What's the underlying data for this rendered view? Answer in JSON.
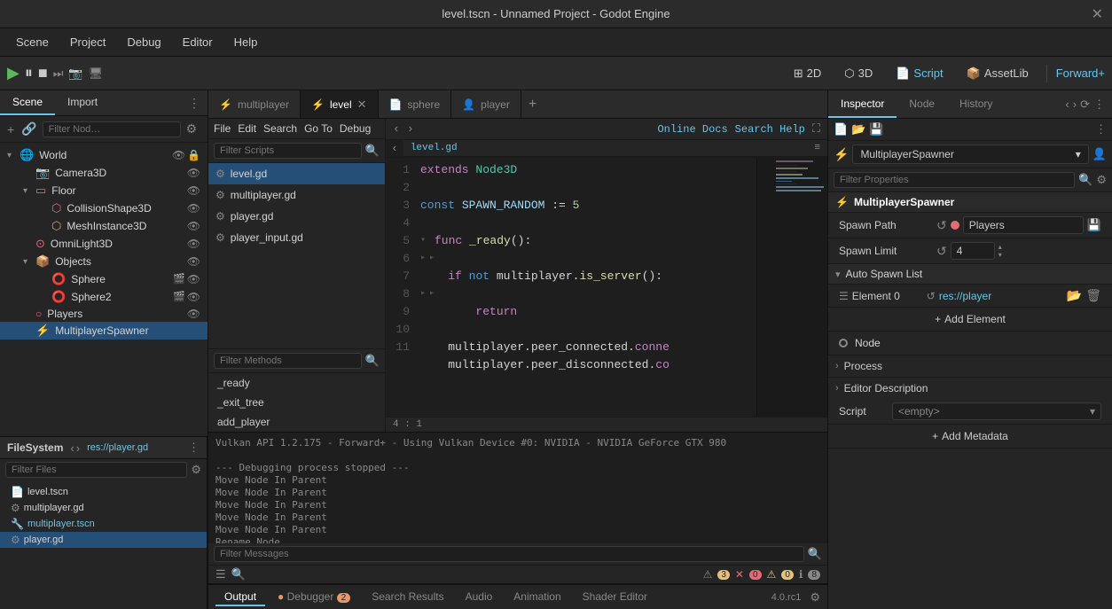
{
  "titleBar": {
    "title": "level.tscn - Unnamed Project - Godot Engine",
    "closeIcon": "✕"
  },
  "menuBar": {
    "items": [
      "Scene",
      "Project",
      "Debug",
      "Editor",
      "Help"
    ]
  },
  "toolbar": {
    "buttons": [
      {
        "label": "2D",
        "icon": "⊞",
        "active": false
      },
      {
        "label": "3D",
        "icon": "⬡",
        "active": false
      },
      {
        "label": "Script",
        "icon": "📄",
        "active": true
      },
      {
        "label": "AssetLib",
        "icon": "📦",
        "active": false
      }
    ],
    "playBtn": "▶",
    "pauseBtn": "⏸",
    "stopBtn": "■",
    "forwardPlus": "Forward+"
  },
  "scene": {
    "tabs": [
      "Scene",
      "Import"
    ],
    "activeTab": "Scene",
    "filterPlaceholder": "Filter Nod…",
    "tree": [
      {
        "label": "World",
        "icon": "🌐",
        "color": "node-blue",
        "depth": 0,
        "expanded": true,
        "hasEye": true
      },
      {
        "label": "Camera3D",
        "icon": "📷",
        "color": "node-red",
        "depth": 1,
        "hasEye": true
      },
      {
        "label": "Floor",
        "icon": "▭",
        "color": "node-red",
        "depth": 1,
        "expanded": true,
        "hasEye": true
      },
      {
        "label": "CollisionShape3D",
        "icon": "⬡",
        "color": "node-red",
        "depth": 2,
        "hasEye": true
      },
      {
        "label": "MeshInstance3D",
        "icon": "⬡",
        "color": "node-orange",
        "depth": 2,
        "hasEye": true
      },
      {
        "label": "OmniLight3D",
        "icon": "⊙",
        "color": "node-red",
        "depth": 1,
        "hasEye": true
      },
      {
        "label": "Objects",
        "icon": "📦",
        "color": "node-red",
        "depth": 1,
        "expanded": true,
        "hasEye": true
      },
      {
        "label": "Sphere",
        "icon": "⭕",
        "color": "node-orange",
        "depth": 2,
        "hasEye": true
      },
      {
        "label": "Sphere2",
        "icon": "⭕",
        "color": "node-orange",
        "depth": 2,
        "hasEye": true
      },
      {
        "label": "Players",
        "icon": "○",
        "color": "node-red",
        "depth": 1,
        "hasEye": true
      },
      {
        "label": "MultiplayerSpawner",
        "icon": "⚡",
        "color": "node-blue",
        "depth": 1,
        "selected": true,
        "hasEye": false
      }
    ]
  },
  "filesystem": {
    "title": "FileSystem",
    "path": "res://player.gd",
    "filterPlaceholder": "Filter Files",
    "items": [
      {
        "label": "level.tscn",
        "icon": "📄",
        "color": "orange"
      },
      {
        "label": "multiplayer.gd",
        "icon": "⚙",
        "color": "normal"
      },
      {
        "label": "multiplayer.tscn",
        "icon": "🔧",
        "color": "blue",
        "selected": false
      },
      {
        "label": "player.gd",
        "icon": "⚙",
        "color": "normal",
        "selected": true
      }
    ]
  },
  "editorTabs": [
    {
      "label": "multiplayer",
      "icon": "⚡",
      "closeable": false
    },
    {
      "label": "level",
      "icon": "⚡",
      "closeable": true,
      "active": true
    },
    {
      "label": "sphere",
      "icon": "📄",
      "closeable": false
    },
    {
      "label": "player",
      "icon": "👤",
      "closeable": false
    }
  ],
  "codeEditor": {
    "toolbar": {
      "file": "File",
      "edit": "Edit",
      "search": "Search",
      "goTo": "Go To",
      "debug": "Debug",
      "onlineHelp": "Online Docs",
      "searchHelp": "Search Help"
    },
    "scripts": [
      {
        "label": "level.gd",
        "active": true
      },
      {
        "label": "multiplayer.gd"
      },
      {
        "label": "player.gd"
      },
      {
        "label": "player_input.gd"
      }
    ],
    "breadcrumb": "level.gd",
    "methods": [
      "_ready",
      "_exit_tree",
      "add_player"
    ],
    "lines": [
      {
        "num": 1,
        "code": "extends Node3D"
      },
      {
        "num": 2,
        "code": ""
      },
      {
        "num": 3,
        "code": "const SPAWN_RANDOM := 5"
      },
      {
        "num": 4,
        "code": ""
      },
      {
        "num": 5,
        "code": "func _ready():"
      },
      {
        "num": 6,
        "code": "    if not multiplayer.is_server():"
      },
      {
        "num": 7,
        "code": "        return"
      },
      {
        "num": 8,
        "code": ""
      },
      {
        "num": 9,
        "code": "    multiplayer.peer_connected.conne"
      },
      {
        "num": 10,
        "code": "    multiplayer.peer_disconnected.co"
      },
      {
        "num": 11,
        "code": ""
      }
    ],
    "cursorPos": "4 : 1"
  },
  "console": {
    "output": [
      "Vulkan API 1.2.175 - Forward+ - Using Vulkan Device #0: NVIDIA - NVIDIA GeForce GTX 980",
      "",
      "--- Debugging process stopped ---",
      "Move Node In Parent",
      "Move Node In Parent",
      "Move Node In Parent",
      "Move Node In Parent",
      "Move Node In Parent",
      "Rename Node"
    ],
    "filterPlaceholder": "Filter Messages",
    "tabs": [
      "Output",
      "Debugger (2)",
      "Search Results",
      "Audio",
      "Animation",
      "Shader Editor"
    ],
    "activeTab": "Output",
    "debuggerCount": 2,
    "badges": {
      "warn": 3,
      "error": 0,
      "info": 0,
      "msg": 8
    },
    "version": "4.0.rc1"
  },
  "inspector": {
    "tabs": [
      "Inspector",
      "Node",
      "History"
    ],
    "activeTab": "Inspector",
    "selectedNode": "MultiplayerSpawner",
    "filterPlaceholder": "Filter Properties",
    "sectionTitle": "MultiplayerSpawner",
    "properties": {
      "spawnPath": {
        "label": "Spawn Path",
        "value": "Players"
      },
      "spawnLimit": {
        "label": "Spawn Limit",
        "value": "4"
      }
    },
    "autoSpawnList": {
      "title": "Auto Spawn List",
      "element0": {
        "label": "Element 0",
        "value": "res://player"
      }
    },
    "addElementBtn": "Add Element",
    "nodeRow": "Node",
    "procesSection": "Process",
    "editorDescription": {
      "title": "Editor Description",
      "scriptLabel": "Script",
      "scriptValue": "<empty>",
      "addMetadataBtn": "Add Metadata"
    }
  }
}
